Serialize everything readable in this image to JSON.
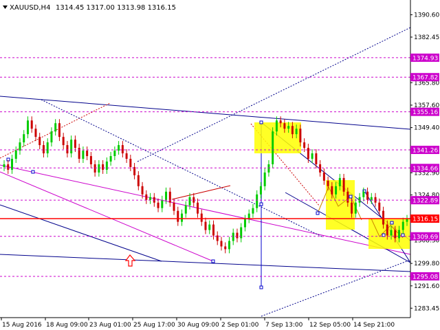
{
  "header": {
    "symbol": "XAUUSD,H4",
    "ohlc": "1314.45 1317.00 1313.98 1316.15",
    "arrow_icon": "triangle-down-icon"
  },
  "chart_data": {
    "type": "candlestick",
    "symbol": "XAUUSD",
    "timeframe": "H4",
    "ohlc": {
      "open": 1314.45,
      "high": 1317.0,
      "low": 1313.98,
      "close": 1316.15
    },
    "ylim": [
      1280.0,
      1396.0
    ],
    "yticks": [
      "1390.60",
      "1382.45",
      "1365.80",
      "1357.60",
      "1349.40",
      "1332.90",
      "1324.80",
      "1308.30",
      "1299.80",
      "1291.60",
      "1283.45"
    ],
    "xticks": [
      "15 Aug 2016",
      "18 Aug 09:00",
      "23 Aug 01:00",
      "25 Aug 17:00",
      "30 Aug 09:00",
      "2 Sep 01:00",
      "7 Sep 13:00",
      "12 Sep 05:00",
      "14 Sep 21:00"
    ],
    "grid": false,
    "up_color": "#00cc00",
    "down_color": "#cc0000",
    "levels": [
      {
        "value": 1374.93,
        "label": "1374.93",
        "style": "dashed",
        "color": "#cc00cc"
      },
      {
        "value": 1367.82,
        "label": "1367.82",
        "style": "dashed",
        "color": "#cc00cc"
      },
      {
        "value": 1355.16,
        "label": "1355.16",
        "style": "dashed",
        "color": "#cc00cc"
      },
      {
        "value": 1341.26,
        "label": "1341.26",
        "style": "dashed",
        "color": "#cc00cc"
      },
      {
        "value": 1334.66,
        "label": "1334.66",
        "style": "dashed",
        "color": "#cc00cc"
      },
      {
        "value": 1322.89,
        "label": "1322.89",
        "style": "dashed",
        "color": "#cc00cc"
      },
      {
        "value": 1316.15,
        "label": "1316.15",
        "style": "solid",
        "color": "#ff0000"
      },
      {
        "value": 1309.69,
        "label": "1309.69",
        "style": "dashed",
        "color": "#cc00cc"
      },
      {
        "value": 1295.08,
        "label": "1295.08",
        "style": "dashed",
        "color": "#cc00cc"
      }
    ],
    "closes": [
      1336,
      1334,
      1338,
      1341,
      1344,
      1347,
      1352,
      1349,
      1346,
      1343,
      1340,
      1344,
      1348,
      1351,
      1346,
      1343,
      1340,
      1345,
      1342,
      1338,
      1341,
      1339,
      1336,
      1333,
      1336,
      1334,
      1337,
      1339,
      1341,
      1343,
      1340,
      1338,
      1335,
      1332,
      1328,
      1325,
      1323,
      1324,
      1322,
      1320,
      1323,
      1326,
      1322,
      1319,
      1315,
      1318,
      1321,
      1324,
      1322,
      1318,
      1315,
      1312,
      1314,
      1310,
      1308,
      1306,
      1305,
      1308,
      1311,
      1309,
      1313,
      1316,
      1318,
      1320,
      1325,
      1328,
      1333,
      1336,
      1348,
      1352,
      1351,
      1349,
      1350,
      1347,
      1349,
      1344,
      1342,
      1338,
      1340,
      1336,
      1333,
      1330,
      1328,
      1325,
      1328,
      1331,
      1326,
      1322,
      1318,
      1322,
      1324,
      1326,
      1323,
      1324,
      1322,
      1319,
      1314,
      1310,
      1312,
      1309,
      1312,
      1315,
      1316
    ]
  }
}
